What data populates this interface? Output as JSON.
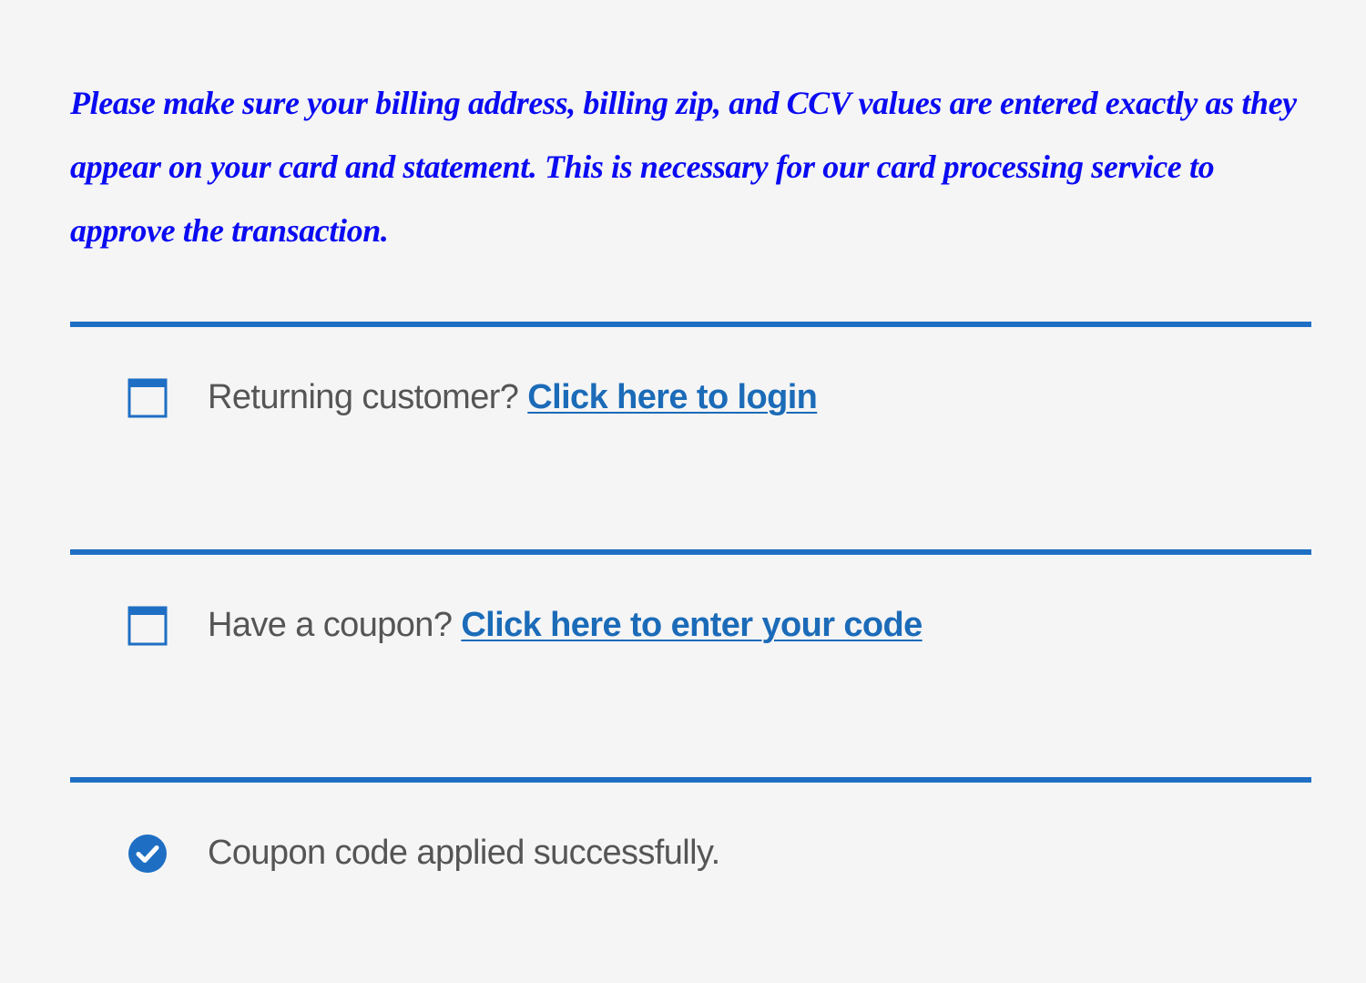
{
  "notice": {
    "text": "Please make sure your billing address, billing zip, and CCV values are entered exactly as they appear on your card and statement. This is necessary for our card processing service to approve the transaction."
  },
  "login_notice": {
    "icon": "window-icon",
    "prompt": "Returning customer?",
    "link": "Click here to login"
  },
  "coupon_notice": {
    "icon": "window-icon",
    "prompt": "Have a coupon?",
    "link": "Click here to enter your code"
  },
  "success_notice": {
    "icon": "check-circle-icon",
    "message": "Coupon code applied successfully."
  },
  "colors": {
    "notice_text": "#0b0bf2",
    "accent": "#1e6fc4",
    "link": "#1b6bb8",
    "body_text": "#555555",
    "background": "#f5f5f5"
  }
}
